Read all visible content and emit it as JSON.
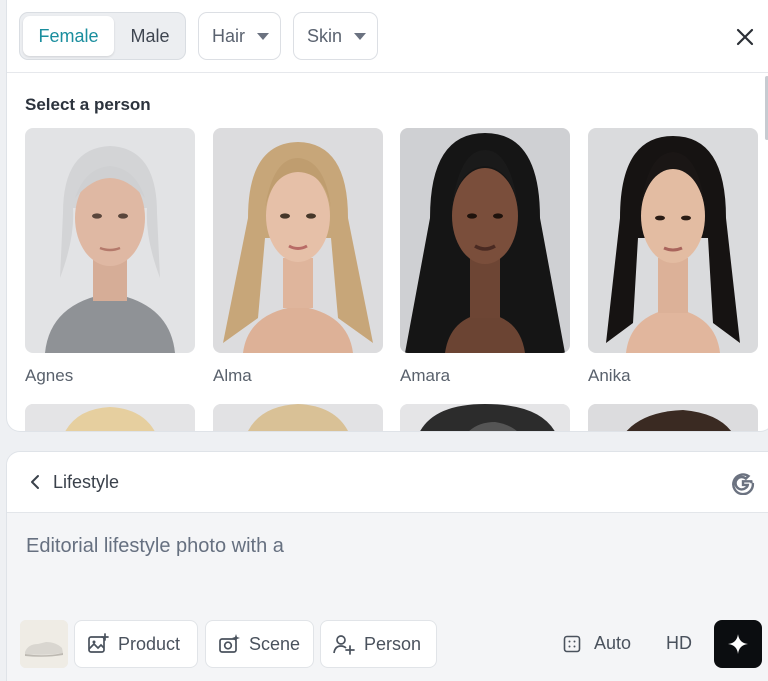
{
  "filters": {
    "gender_options": [
      "Female",
      "Male"
    ],
    "gender_selected": "Female",
    "hair_label": "Hair",
    "skin_label": "Skin"
  },
  "picker": {
    "section_title": "Select a person",
    "people": [
      {
        "name": "Agnes"
      },
      {
        "name": "Alma"
      },
      {
        "name": "Amara"
      },
      {
        "name": "Anika"
      }
    ]
  },
  "composer": {
    "back_label": "Lifestyle",
    "prompt_text": "Editorial lifestyle photo with a",
    "buttons": {
      "product": "Product",
      "scene": "Scene",
      "person": "Person",
      "auto": "Auto",
      "hd": "HD"
    }
  },
  "colors": {
    "accent": "#1a8e9e",
    "generate_button": "#0b0d10"
  },
  "icons": [
    "chevron-down-icon",
    "close-icon",
    "chevron-left-icon",
    "google-icon",
    "image-plus-icon",
    "camera-sparkle-icon",
    "person-plus-icon",
    "aspect-ratio-icon",
    "sparkle-icon"
  ]
}
